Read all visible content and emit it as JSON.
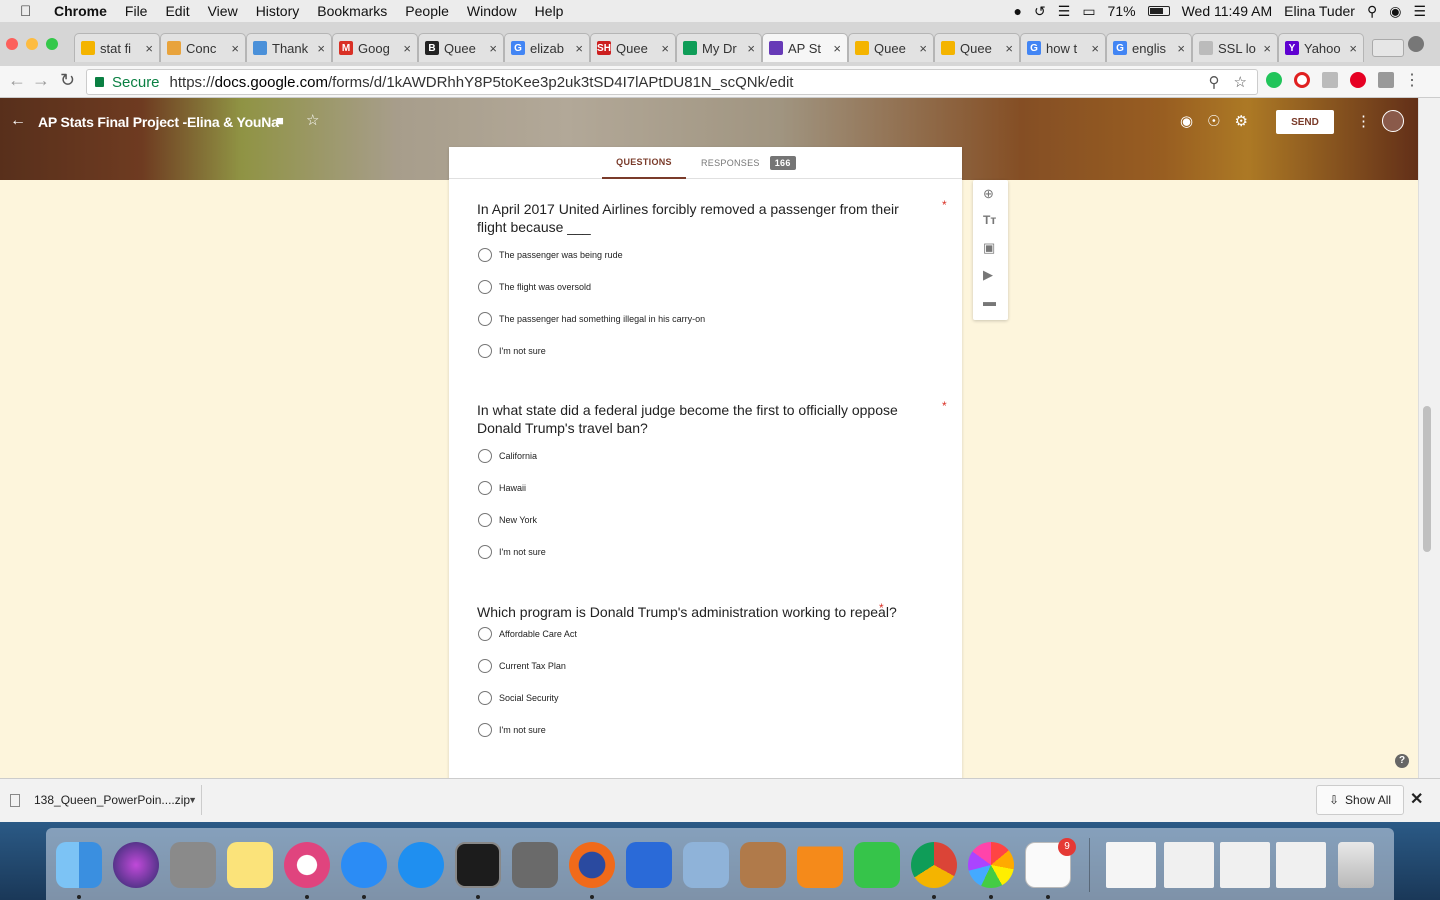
{
  "menubar": {
    "app": "Chrome",
    "items": [
      "File",
      "Edit",
      "View",
      "History",
      "Bookmarks",
      "People",
      "Window",
      "Help"
    ],
    "battery": "71%",
    "clock": "Wed 11:49 AM",
    "user": "Elina Tuder"
  },
  "tabs": [
    {
      "title": "stat fi",
      "color": "#f4b400",
      "glyph": ""
    },
    {
      "title": "Conc",
      "color": "#e8a33c",
      "glyph": ""
    },
    {
      "title": "Thank",
      "color": "#4a90d9",
      "glyph": ""
    },
    {
      "title": "Goog",
      "color": "#d93025",
      "glyph": "M"
    },
    {
      "title": "Quee",
      "color": "#222222",
      "glyph": "B"
    },
    {
      "title": "elizab",
      "color": "#4285f4",
      "glyph": "G"
    },
    {
      "title": "Quee",
      "color": "#cc1f1f",
      "glyph": "SH"
    },
    {
      "title": "My Dr",
      "color": "#0f9d58",
      "glyph": ""
    },
    {
      "title": "AP St",
      "color": "#673ab7",
      "glyph": ""
    },
    {
      "title": "Quee",
      "color": "#f4b400",
      "glyph": ""
    },
    {
      "title": "Quee",
      "color": "#f4b400",
      "glyph": ""
    },
    {
      "title": "how t",
      "color": "#4285f4",
      "glyph": "G"
    },
    {
      "title": "englis",
      "color": "#4285f4",
      "glyph": "G"
    },
    {
      "title": "SSL lo",
      "color": "#bbbbbb",
      "glyph": ""
    },
    {
      "title": "Yahoo",
      "color": "#5f01d1",
      "glyph": "Y"
    }
  ],
  "address": {
    "secure_label": "Secure",
    "url_prefix": "https://",
    "url_domain": "docs.google.com",
    "url_path": "/forms/d/1kAWDRhhY8P5toKee3p2uk3tSD4I7lAPtDU81N_scQNk/edit"
  },
  "form": {
    "title": "AP Stats Final Project -Elina & YouNa",
    "send_label": "SEND",
    "questions_tab": "QUESTIONS",
    "responses_tab": "RESPONSES",
    "responses_count": "166",
    "questions": [
      {
        "title": "In April 2017 United Airlines forcibly removed a passenger from their flight because ___",
        "options": [
          "The passenger was being rude",
          "The flight was oversold",
          "The passenger had something illegal in his carry-on",
          "I'm not sure"
        ]
      },
      {
        "title": "In what state did a federal judge become the first to officially oppose Donald Trump's travel ban?",
        "options": [
          "California",
          "Hawaii",
          "New York",
          "I'm not sure"
        ]
      },
      {
        "title": "Which program is Donald Trump's administration working to repeal?",
        "options": [
          "Affordable Care Act",
          "Current Tax Plan",
          "Social Security",
          "I'm not sure"
        ]
      }
    ],
    "required_mark": "*"
  },
  "download": {
    "file": "138_Queen_PowerPoin....zip",
    "show_all": "Show All"
  },
  "dock": {
    "reminders_badge": "9"
  }
}
